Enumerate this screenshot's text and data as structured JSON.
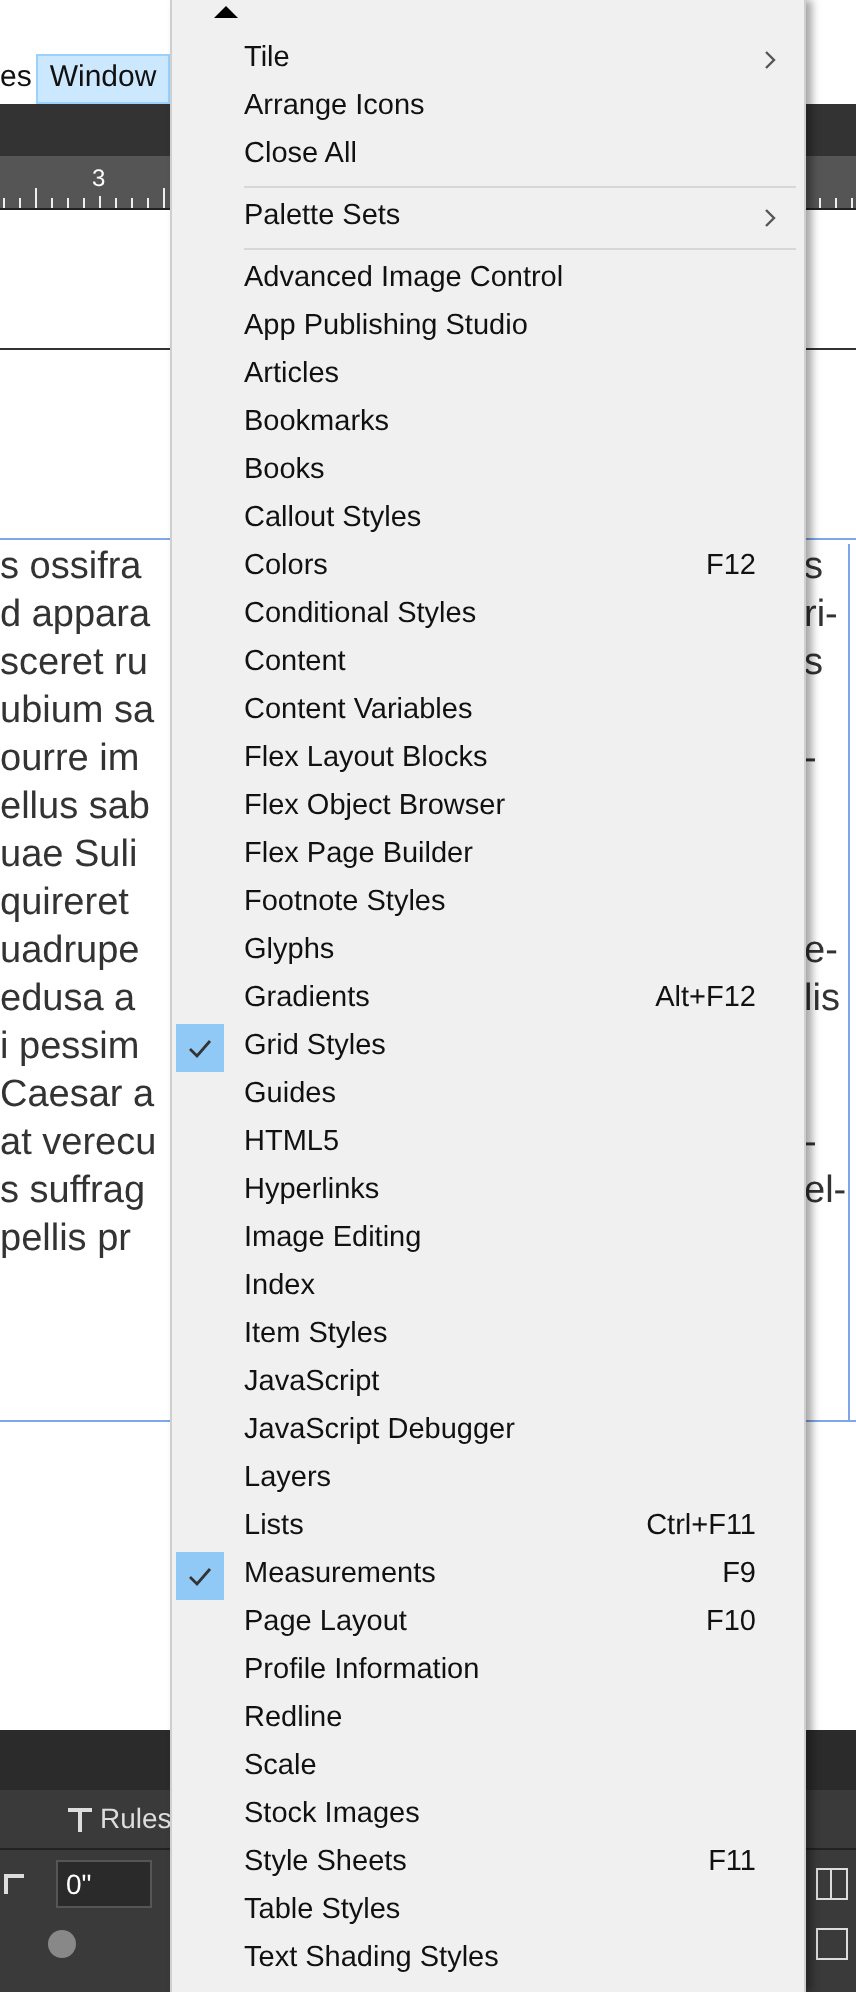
{
  "menubar": [
    {
      "label": "es",
      "selected": false
    },
    {
      "label": "Window",
      "selected": true
    }
  ],
  "ruler": {
    "label": "3"
  },
  "document": {
    "left_lines": [
      "s ossifra",
      "d appara",
      "sceret ru",
      "ubium sa",
      "ourre im",
      "ellus sab",
      "uae Suli",
      "quireret",
      "uadrupe",
      "edusa a",
      "i pessim",
      "Caesar a",
      "at verecu",
      "s suffrag",
      "pellis pr"
    ],
    "right_blocks": [
      [
        "s",
        "ri-",
        "s"
      ],
      [
        "-"
      ],
      [
        "e-",
        "lis"
      ],
      [
        "-",
        "el-"
      ]
    ]
  },
  "panel": {
    "tab": "Rules",
    "field_value": "0\""
  },
  "menu": {
    "items": [
      {
        "kind": "item",
        "label": "Tile",
        "submenu": true,
        "checked": false
      },
      {
        "kind": "item",
        "label": "Arrange Icons",
        "checked": false
      },
      {
        "kind": "item",
        "label": "Close All",
        "checked": false
      },
      {
        "kind": "separator"
      },
      {
        "kind": "item",
        "label": "Palette Sets",
        "submenu": true,
        "checked": false
      },
      {
        "kind": "separator"
      },
      {
        "kind": "item",
        "label": "Advanced Image Control",
        "checked": false
      },
      {
        "kind": "item",
        "label": "App Publishing Studio",
        "checked": false
      },
      {
        "kind": "item",
        "label": "Articles",
        "checked": false
      },
      {
        "kind": "item",
        "label": "Bookmarks",
        "checked": false
      },
      {
        "kind": "item",
        "label": "Books",
        "checked": false
      },
      {
        "kind": "item",
        "label": "Callout Styles",
        "checked": false
      },
      {
        "kind": "item",
        "label": "Colors",
        "shortcut": "F12",
        "checked": false
      },
      {
        "kind": "item",
        "label": "Conditional Styles",
        "checked": false
      },
      {
        "kind": "item",
        "label": "Content",
        "checked": false
      },
      {
        "kind": "item",
        "label": "Content Variables",
        "checked": false
      },
      {
        "kind": "item",
        "label": "Flex Layout Blocks",
        "checked": false
      },
      {
        "kind": "item",
        "label": "Flex Object Browser",
        "checked": false
      },
      {
        "kind": "item",
        "label": "Flex Page Builder",
        "checked": false
      },
      {
        "kind": "item",
        "label": "Footnote Styles",
        "checked": false
      },
      {
        "kind": "item",
        "label": "Glyphs",
        "checked": false
      },
      {
        "kind": "item",
        "label": "Gradients",
        "shortcut": "Alt+F12",
        "checked": false
      },
      {
        "kind": "item",
        "label": "Grid Styles",
        "checked": true
      },
      {
        "kind": "item",
        "label": "Guides",
        "checked": false
      },
      {
        "kind": "item",
        "label": "HTML5",
        "checked": false
      },
      {
        "kind": "item",
        "label": "Hyperlinks",
        "checked": false
      },
      {
        "kind": "item",
        "label": "Image Editing",
        "checked": false
      },
      {
        "kind": "item",
        "label": "Index",
        "checked": false
      },
      {
        "kind": "item",
        "label": "Item Styles",
        "checked": false
      },
      {
        "kind": "item",
        "label": "JavaScript",
        "checked": false
      },
      {
        "kind": "item",
        "label": "JavaScript Debugger",
        "checked": false
      },
      {
        "kind": "item",
        "label": "Layers",
        "checked": false
      },
      {
        "kind": "item",
        "label": "Lists",
        "shortcut": "Ctrl+F11",
        "checked": false
      },
      {
        "kind": "item",
        "label": "Measurements",
        "shortcut": "F9",
        "checked": true
      },
      {
        "kind": "item",
        "label": "Page Layout",
        "shortcut": "F10",
        "checked": false
      },
      {
        "kind": "item",
        "label": "Profile Information",
        "checked": false
      },
      {
        "kind": "item",
        "label": "Redline",
        "checked": false
      },
      {
        "kind": "item",
        "label": "Scale",
        "checked": false
      },
      {
        "kind": "item",
        "label": "Stock Images",
        "checked": false
      },
      {
        "kind": "item",
        "label": "Style Sheets",
        "shortcut": "F11",
        "checked": false
      },
      {
        "kind": "item",
        "label": "Table Styles",
        "checked": false
      },
      {
        "kind": "item",
        "label": "Text Shading Styles",
        "checked": false
      }
    ]
  }
}
